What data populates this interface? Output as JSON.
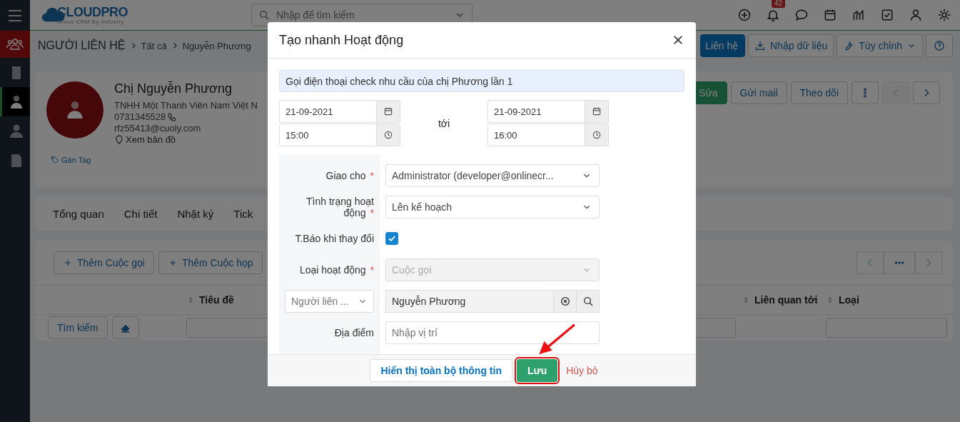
{
  "topbar": {
    "logo": "CLOUDPRO",
    "tagline": "Cloud CRM By Industry",
    "search": {
      "placeholder": "Nhập để tìm kiếm"
    },
    "notification_count": "42"
  },
  "sidebar": {
    "items": [
      {
        "selected": false
      },
      {
        "selected": true
      },
      {
        "selected": false
      },
      {
        "selected": false
      }
    ]
  },
  "breadcrumb": [
    "NGƯỜI LIÊN HỆ",
    "Tất cả",
    "Nguyễn Phương"
  ],
  "header_buttons": [
    {
      "kind": "primary",
      "label": "Liên hệ"
    },
    {
      "kind": "import",
      "label": "Nhập dữ liệu"
    },
    {
      "kind": "dropdown",
      "label": "Tùy chỉnh"
    },
    {
      "kind": "help"
    }
  ],
  "profile": {
    "name": "Chị Nguyễn Phương",
    "company": "TNHH Một Thanh Viên Nam Việt N",
    "phone": "0731345528",
    "email": "rfz55413@cuoly.com",
    "map_link": "Xem bản đồ",
    "tag_link": "Gán Tag"
  },
  "actions": [
    {
      "kind": "primary",
      "label": "Sửa"
    },
    {
      "kind": "default",
      "label": "Gửi mail"
    },
    {
      "kind": "default",
      "label": "Theo dõi"
    },
    {
      "kind": "more"
    },
    {
      "kind": "prev",
      "disabled": true
    },
    {
      "kind": "next",
      "disabled": false
    }
  ],
  "tabs": [
    {
      "label": "Tổng quan",
      "selected": false
    },
    {
      "label": "Chi tiết",
      "selected": false
    },
    {
      "label": "Nhật ký",
      "selected": false
    },
    {
      "label": "Tick",
      "selected": false
    }
  ],
  "related": {
    "add_buttons": [
      "Thêm Cuộc gọi",
      "Thêm Cuộc họp"
    ],
    "pager": {
      "prev_disabled": true,
      "next_disabled": true
    },
    "columns": [
      {
        "label": "Tiêu đề"
      },
      {
        "label": "Liên quan tới"
      },
      {
        "label": "Loại"
      }
    ],
    "search_button": "Tìm kiếm"
  },
  "modal": {
    "title": "Tạo nhanh Hoạt động",
    "required_mark": "*",
    "subject": "Gọi điện thoại check nhu cầu của chị Phương lần 1",
    "start": {
      "date": "21-09-2021",
      "time": "15:00"
    },
    "to_label": "tới",
    "end": {
      "date": "21-09-2021",
      "time": "16:00"
    },
    "fields": [
      {
        "kind": "select",
        "label": "Giao cho",
        "required": true,
        "value": "Administrator (developer@onlinecr...",
        "disabled": false
      },
      {
        "kind": "select",
        "label": "Tình trạng hoạt động",
        "required": true,
        "value": "Lên kế hoạch",
        "disabled": false
      },
      {
        "kind": "checkbox",
        "label": "T.Báo khi thay đổi",
        "required": false,
        "checked": true
      },
      {
        "kind": "select",
        "label": "Loại hoạt động",
        "required": true,
        "value": "Cuộc gọi",
        "disabled": true
      },
      {
        "kind": "related",
        "module": "Người liên ...",
        "value": "Nguyễn Phương"
      },
      {
        "kind": "text",
        "label": "Địa điểm",
        "required": false,
        "placeholder": "Nhập vị trí"
      }
    ],
    "footer_buttons": [
      {
        "kind": "secondary",
        "label": "Hiển thị toàn bộ thông tin",
        "highlighted": false
      },
      {
        "kind": "primary",
        "label": "Lưu",
        "highlighted": true
      },
      {
        "kind": "link",
        "label": "Hủy bỏ",
        "highlighted": false
      }
    ]
  }
}
